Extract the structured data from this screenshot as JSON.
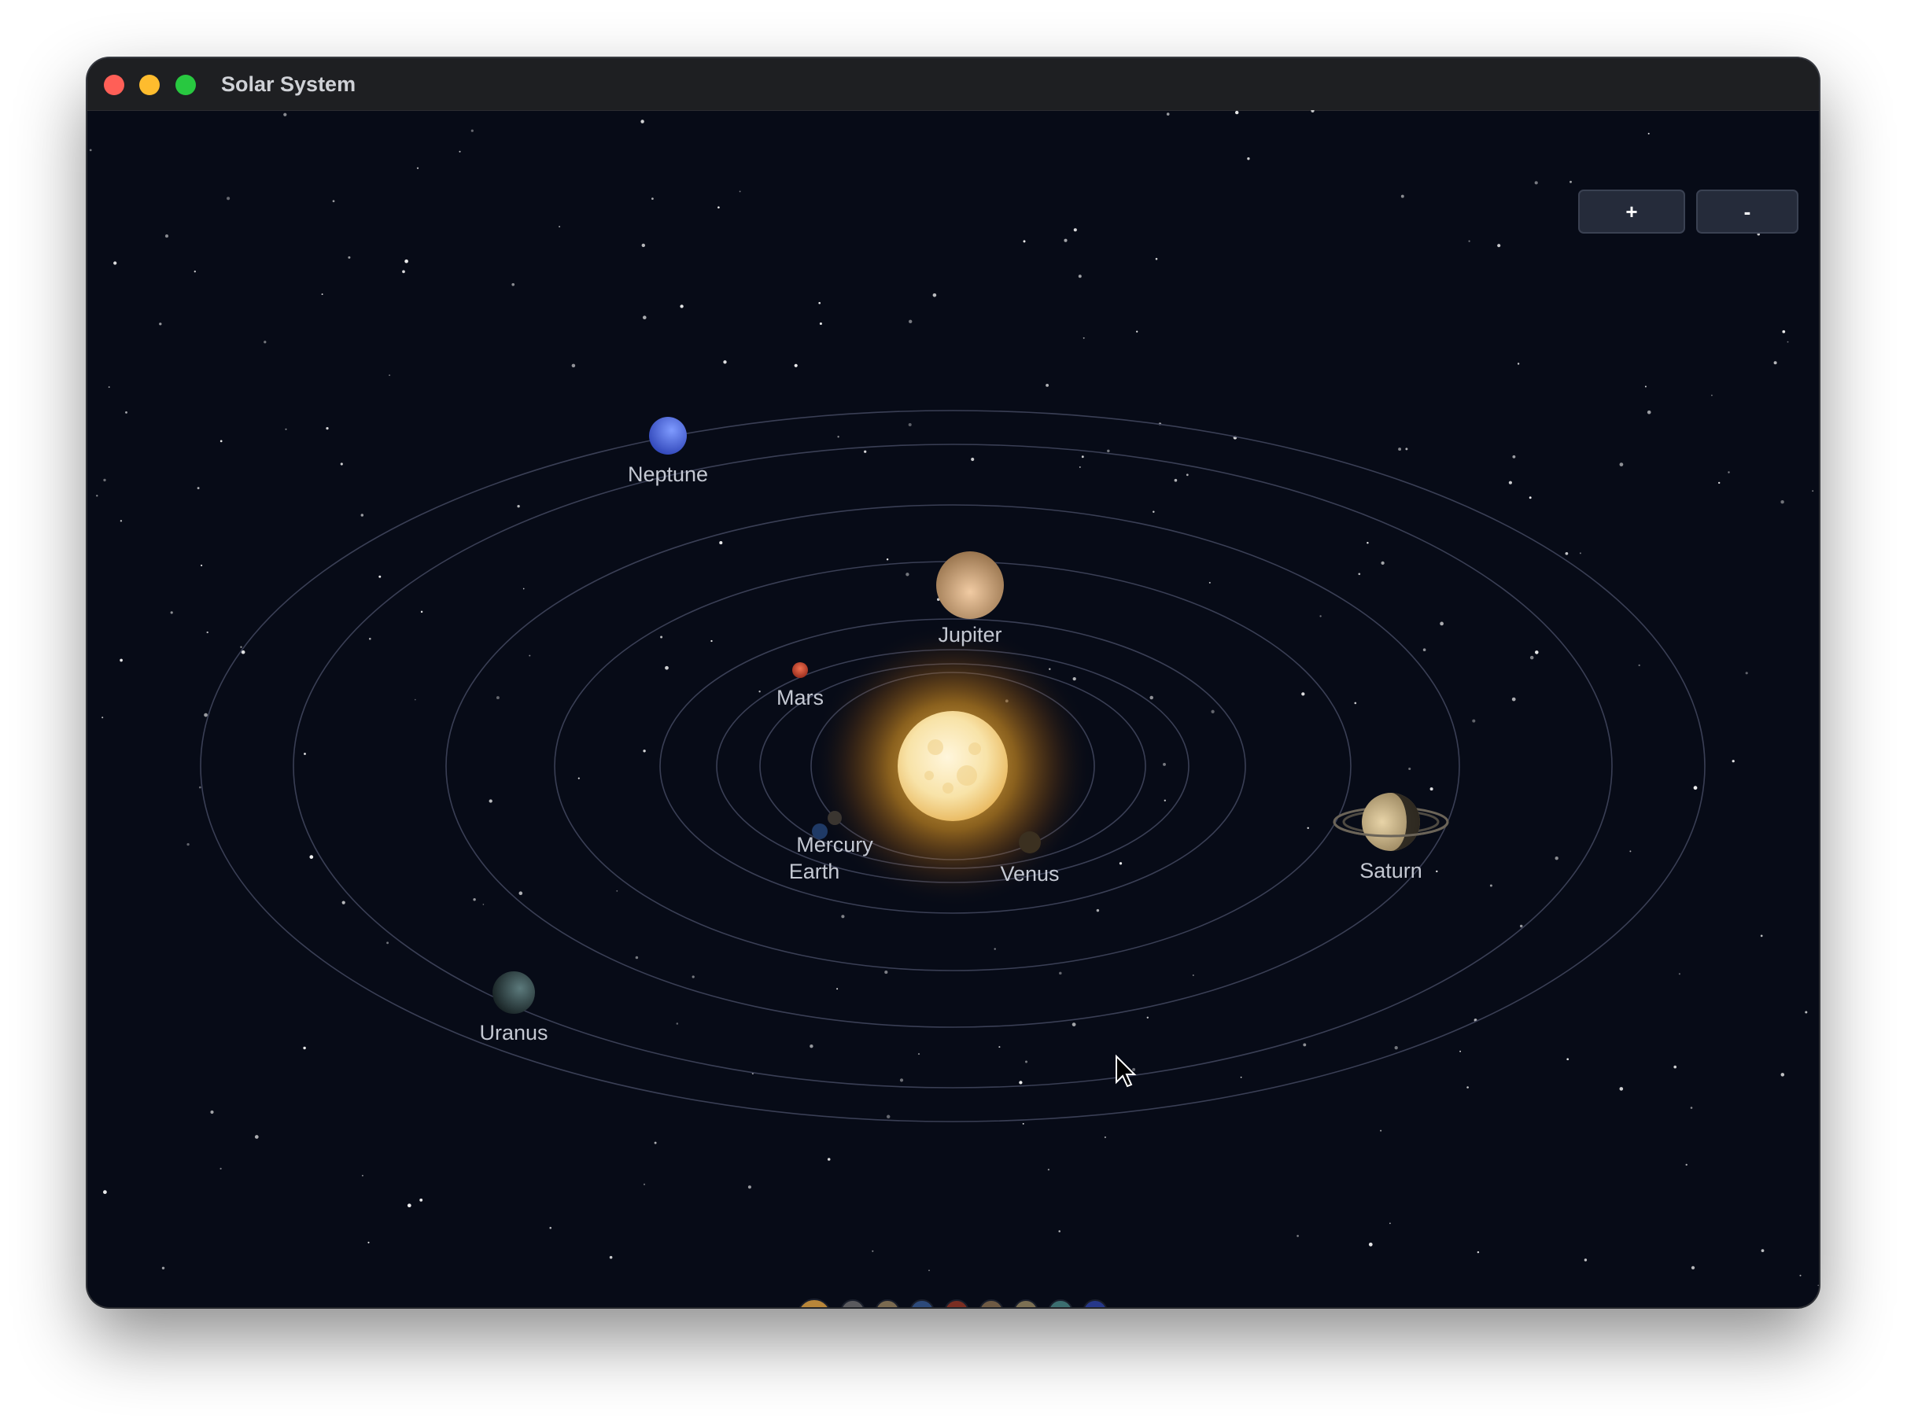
{
  "window": {
    "title": "Solar System"
  },
  "controls": {
    "zoom_in_label": "+",
    "zoom_out_label": "-"
  },
  "bodies": {
    "sun": {
      "color": "#f8e3a8"
    },
    "mercury": {
      "name": "Mercury",
      "color": "#3a3530"
    },
    "venus": {
      "name": "Venus",
      "color": "#3b3020"
    },
    "earth": {
      "name": "Earth",
      "color": "#1f3a66"
    },
    "mars": {
      "name": "Mars",
      "color": "#d4573a"
    },
    "jupiter": {
      "name": "Jupiter",
      "color": "#e0b48c"
    },
    "saturn": {
      "name": "Saturn",
      "color": "#c9b48a"
    },
    "uranus": {
      "name": "Uranus",
      "color": "#2e3a3c"
    },
    "neptune": {
      "name": "Neptune",
      "color": "#4f6fe8"
    }
  },
  "selector_colors": [
    "#b8863a",
    "#5a5a5e",
    "#7a6a50",
    "#2d4a7a",
    "#7a2e22",
    "#6e5a44",
    "#7c7054",
    "#3c6e70",
    "#26388a"
  ],
  "colors": {
    "space": "#070b17",
    "orbit": "#3a3f55",
    "label": "#c4c8d2"
  }
}
